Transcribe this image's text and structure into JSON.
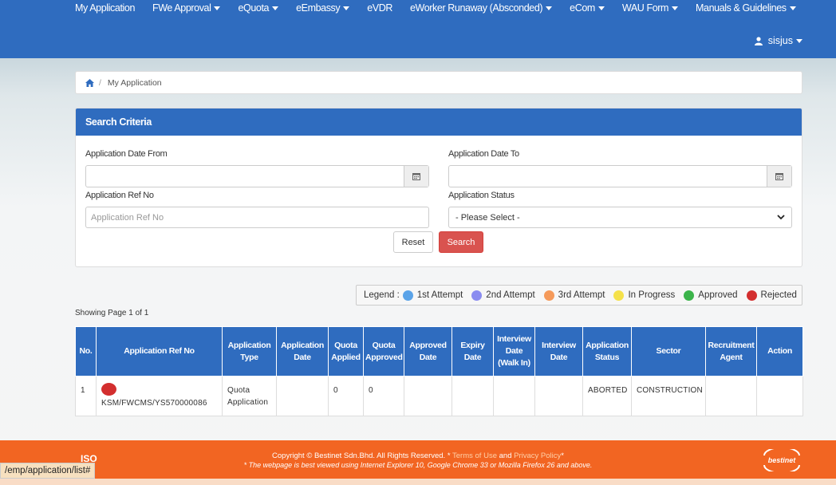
{
  "nav": {
    "items": [
      {
        "label": "My Application",
        "caret": false
      },
      {
        "label": "FWe Approval",
        "caret": true
      },
      {
        "label": "eQuota",
        "caret": true
      },
      {
        "label": "eEmbassy",
        "caret": true
      },
      {
        "label": "eVDR",
        "caret": false
      },
      {
        "label": "eWorker Runaway (Absconded)",
        "caret": true
      },
      {
        "label": "eCom",
        "caret": true
      },
      {
        "label": "WAU Form",
        "caret": true
      },
      {
        "label": "Manuals & Guidelines",
        "caret": true
      }
    ],
    "user": "sisjus",
    "color": "#2f6cbf"
  },
  "breadcrumb": {
    "separator": "/",
    "current": "My Application"
  },
  "search": {
    "title": "Search Criteria",
    "date_from_label": "Application Date From",
    "date_to_label": "Application Date To",
    "ref_label": "Application Ref No",
    "ref_placeholder": "Application Ref No",
    "status_label": "Application Status",
    "status_selected": "- Please Select -",
    "reset_label": "Reset",
    "search_label": "Search"
  },
  "legend": {
    "prefix": "Legend :",
    "items": [
      {
        "label": "1st Attempt",
        "color": "#5aa3e8"
      },
      {
        "label": "2nd Attempt",
        "color": "#8a8cf0"
      },
      {
        "label": "3rd Attempt",
        "color": "#f59a5a"
      },
      {
        "label": "In Progress",
        "color": "#f5e14a"
      },
      {
        "label": "Approved",
        "color": "#3cb44b"
      },
      {
        "label": "Rejected",
        "color": "#d32f2f"
      }
    ]
  },
  "showing": "Showing Page 1 of 1",
  "table": {
    "headers": [
      "No.",
      "Application Ref No",
      "Application Type",
      "Application Date",
      "Quota Applied",
      "Quota Approved",
      "Approved Date",
      "Expiry Date",
      "Interview Date (Walk In)",
      "Interview Date",
      "Application Status",
      "Sector",
      "Recruitment Agent",
      "Action"
    ],
    "rows": [
      {
        "no": "1",
        "ref": "KSM/FWCMS/YS570000086",
        "type": "Quota Application",
        "app_date": "",
        "quota_applied": "0",
        "quota_approved": "0",
        "approved_date": "",
        "expiry_date": "",
        "interview_walkin": "",
        "interview_date": "",
        "status": "ABORTED",
        "sector": "CONSTRUCTION",
        "agent": "",
        "action": "",
        "status_color": "#d32f2f"
      }
    ]
  },
  "footer": {
    "copyright": "Copyright © Bestinet Sdn.Bhd. All Rights Reserved.",
    "terms": "Terms of Use",
    "and": "and",
    "privacy": "Privacy Policy",
    "note": "* The webpage is best viewed using Internet Explorer 10, Google Chrome 33 or Mozilla Firefox 26 and above.",
    "iso": "ISO",
    "brand": "bestinet",
    "color": "#f26522"
  },
  "statusbar": "/emp/application/list#"
}
